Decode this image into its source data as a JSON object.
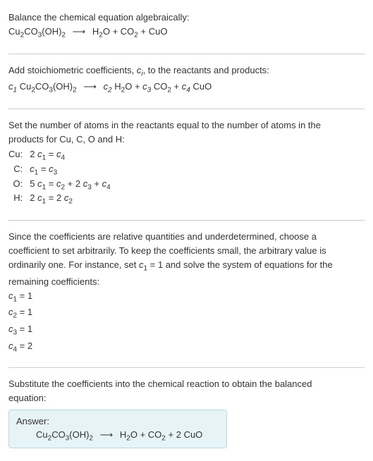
{
  "intro": {
    "line1": "Balance the chemical equation algebraically:"
  },
  "reaction": {
    "reactant1": "Cu",
    "reactant1_sub": "2",
    "reactant1_mid": "CO",
    "reactant1_sub2": "3",
    "reactant1_tail": "(OH)",
    "reactant1_sub3": "2",
    "arrow": "⟶",
    "product1": "H",
    "product1_sub": "2",
    "product1_tail": "O",
    "plus": "+",
    "product2": "CO",
    "product2_sub": "2",
    "product3": "CuO"
  },
  "stoich": {
    "text_a": "Add stoichiometric coefficients, ",
    "ci": "c",
    "ci_sub": "i",
    "text_b": ", to the reactants and products:",
    "c1": "c",
    "c1_sub": "1",
    "c2": "c",
    "c2_sub": "2",
    "c3": "c",
    "c3_sub": "3",
    "c4": "c",
    "c4_sub": "4"
  },
  "atoms": {
    "text1": "Set the number of atoms in the reactants equal to the number of atoms in the",
    "text2": "products for Cu, C, O and H:",
    "rows": [
      {
        "el": "Cu:",
        "eq_a": "2 ",
        "eq_c1": "c",
        "eq_c1s": "1",
        "eq_mid": " = ",
        "eq_c2": "c",
        "eq_c2s": "4"
      },
      {
        "el": "C:",
        "eq_a": "",
        "eq_c1": "c",
        "eq_c1s": "1",
        "eq_mid": " = ",
        "eq_c2": "c",
        "eq_c2s": "3"
      },
      {
        "el": "O:",
        "eq_a": "5 ",
        "eq_c1": "c",
        "eq_c1s": "1",
        "eq_mid": " = ",
        "eq_c2": "c",
        "eq_c2s": "2",
        "eq_plus1": " + 2 ",
        "eq_c3": "c",
        "eq_c3s": "3",
        "eq_plus2": " + ",
        "eq_c4": "c",
        "eq_c4s": "4"
      },
      {
        "el": "H:",
        "eq_a": "2 ",
        "eq_c1": "c",
        "eq_c1s": "1",
        "eq_mid": " = 2 ",
        "eq_c2": "c",
        "eq_c2s": "2"
      }
    ]
  },
  "solve": {
    "text1": "Since the coefficients are relative quantities and underdetermined, choose a",
    "text2": "coefficient to set arbitrarily. To keep the coefficients small, the arbitrary value is",
    "text3_a": "ordinarily one. For instance, set ",
    "text3_c": "c",
    "text3_cs": "1",
    "text3_b": " = 1 and solve the system of equations for the",
    "text4": "remaining coefficients:",
    "vals": [
      {
        "c": "c",
        "s": "1",
        "v": " = 1"
      },
      {
        "c": "c",
        "s": "2",
        "v": " = 1"
      },
      {
        "c": "c",
        "s": "3",
        "v": " = 1"
      },
      {
        "c": "c",
        "s": "4",
        "v": " = 2"
      }
    ]
  },
  "final": {
    "text1": "Substitute the coefficients into the chemical reaction to obtain the balanced",
    "text2": "equation:",
    "answer_label": "Answer:",
    "coef_cuo": "2"
  }
}
